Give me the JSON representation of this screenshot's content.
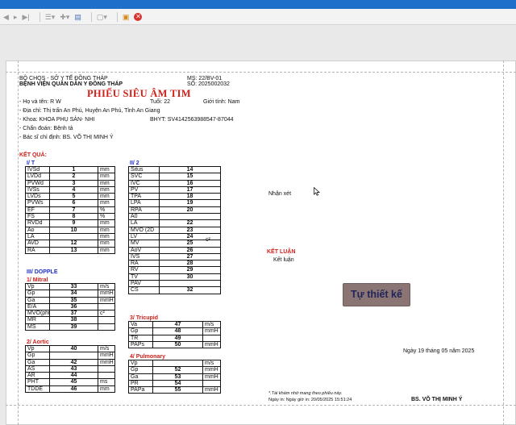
{
  "hospital": {
    "line1": "BỘ CHQS - SỞ Y TẾ ĐỒNG THÁP",
    "line2": "BỆNH VIỆN QUÂN DÂN Y ĐỒNG THÁP",
    "ms": "MS:  22/BV-01",
    "so": "SỐ: 2025002032"
  },
  "title": "PHIẾU SIÊU ÂM TIM",
  "patient": {
    "name": "- Họ và tên: R W",
    "age": "Tuổi: 22",
    "gender": "Giới tính: Nam",
    "address": "- Địa chỉ: Thị trấn An Phú, Huyện An Phú, Tỉnh An Giang",
    "department": "- Khoa: KHOA PHỤ SẢN- NHI",
    "insurance": "BHYT: SV4142563988547-87044",
    "diagnosis": "- Chẩn đoán: Bệnh tả",
    "doctor": "- Bác sĩ chỉ định: BS. VÕ THỊ MINH Ý"
  },
  "results": {
    "heading": "KẾT QUẢ:",
    "sec1": "I/ T",
    "sec2": "II/ 2",
    "sec3": "III/ DOPPLE",
    "mitral": "1/ Mitral",
    "aortic": "2/ Aortic",
    "tricuspid": "3/ Tricupid",
    "pulmonary": "4/ Pulmonary"
  },
  "table_t": [
    [
      "IVSd",
      "1",
      "mm"
    ],
    [
      "LVDd",
      "2",
      "mm"
    ],
    [
      "PVWd",
      "3",
      "mm"
    ],
    [
      "IVSs",
      "4",
      "mm"
    ],
    [
      "LVDs",
      "5",
      "mm"
    ],
    [
      "PVWs",
      "6",
      "mm"
    ],
    [
      "EF",
      "7",
      "%"
    ],
    [
      "FS",
      "8",
      "%"
    ],
    [
      "RVDd",
      "9",
      "mm"
    ],
    [
      "Ao",
      "10",
      "mm"
    ],
    [
      "LA",
      "",
      "mm"
    ],
    [
      "AVD",
      "12",
      "mm"
    ],
    [
      "RA",
      "13",
      "mm"
    ]
  ],
  "table_2": [
    [
      "Situs",
      "14"
    ],
    [
      "SVC",
      "15"
    ],
    [
      "IVC",
      "16"
    ],
    [
      "PV",
      "17"
    ],
    [
      "TPA",
      "18"
    ],
    [
      "LPA",
      "19"
    ],
    [
      "RPA",
      "20"
    ],
    [
      "A0",
      ""
    ],
    [
      "LA",
      "22"
    ],
    [
      "MVO (2D",
      "23"
    ],
    [
      "LV",
      "24"
    ],
    [
      "MV",
      "25"
    ],
    [
      "AoV",
      "26"
    ],
    [
      "IVS",
      "27"
    ],
    [
      "RA",
      "28"
    ],
    [
      "RV",
      "29"
    ],
    [
      "TV",
      "30"
    ],
    [
      "PAV",
      ""
    ],
    [
      "CS",
      "32"
    ]
  ],
  "mvo_unit": "c²",
  "table_mitral": [
    [
      "Vp",
      "33",
      "m/s"
    ],
    [
      "Gp",
      "34",
      "mmH"
    ],
    [
      "Ga",
      "35",
      "mmH"
    ],
    [
      "E/A",
      "36",
      ""
    ],
    [
      "MVO(pht",
      "37",
      "c²"
    ],
    [
      "MR",
      "38",
      ""
    ],
    [
      "MS",
      "39",
      ""
    ]
  ],
  "table_aortic": [
    [
      "Vp",
      "40",
      "m/s"
    ],
    [
      "Gp",
      "",
      "mmH"
    ],
    [
      "Ga",
      "42",
      "mmH"
    ],
    [
      "AS",
      "43",
      ""
    ],
    [
      "AR",
      "44",
      ""
    ],
    [
      "PHT",
      "45",
      "ms"
    ],
    [
      "TDDE",
      "46",
      "mm"
    ]
  ],
  "table_tricuspid": [
    [
      "Va",
      "47",
      "m/s"
    ],
    [
      "Gp",
      "48",
      "mmH"
    ],
    [
      "TR",
      "49",
      ""
    ],
    [
      "PAPs",
      "50",
      "mmH"
    ]
  ],
  "table_pulmonary": [
    [
      "Vp",
      "",
      "m/s"
    ],
    [
      "Gp",
      "52",
      "mmH"
    ],
    [
      "Ga",
      "53",
      "mmH"
    ],
    [
      "PR",
      "54",
      ""
    ],
    [
      "PAPa",
      "55",
      "mmH"
    ]
  ],
  "remarks": {
    "nhan_xet": "Nhận xét",
    "ket_luan_heading": "KẾT LUẬN",
    "ket_luan": "Kết luận"
  },
  "stamp": "Tự thiết kế",
  "date": "Ngày 19 tháng 05 năm 2025",
  "footer": {
    "note": "*.Tái khám nhớ mang theo phiếu này.",
    "printed": "Ngày in: Ngày giờ in: 20/05/2025 15:51:24",
    "signer": "BS. VÕ THỊ MINH Ý"
  }
}
